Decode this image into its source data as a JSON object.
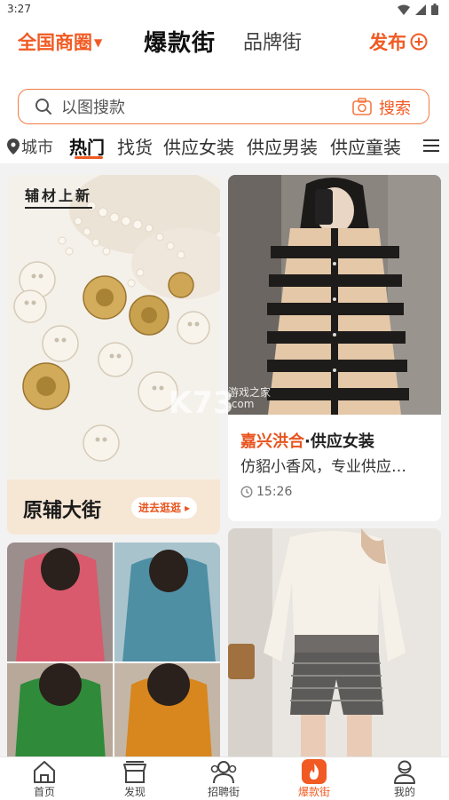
{
  "status_bar": {
    "time": "3:27"
  },
  "header": {
    "region": "全国商圈",
    "tab_hot": "爆款街",
    "tab_brand": "品牌街",
    "publish": "发布"
  },
  "search": {
    "placeholder": "以图搜款",
    "button": "搜索"
  },
  "categories": {
    "city": "城市",
    "items": [
      "热门",
      "找货",
      "供应女装",
      "供应男装",
      "供应童装"
    ],
    "active": "热门"
  },
  "feed": {
    "card1": {
      "tag": "辅材上新",
      "title": "原辅大街",
      "button": "进去逛逛 ▸"
    },
    "card2": {
      "shop": "嘉兴洪合",
      "category": "·供应女装",
      "desc": "仿貂小香风，专业供应…",
      "time": "15:26"
    }
  },
  "watermark": {
    "main": "K73",
    "sub1": "游戏之家",
    "sub2": ".com"
  },
  "bottom_nav": {
    "items": [
      "首页",
      "发现",
      "招聘街",
      "爆款街",
      "我的"
    ],
    "active": "爆款街"
  },
  "colors": {
    "accent": "#f15a22"
  }
}
